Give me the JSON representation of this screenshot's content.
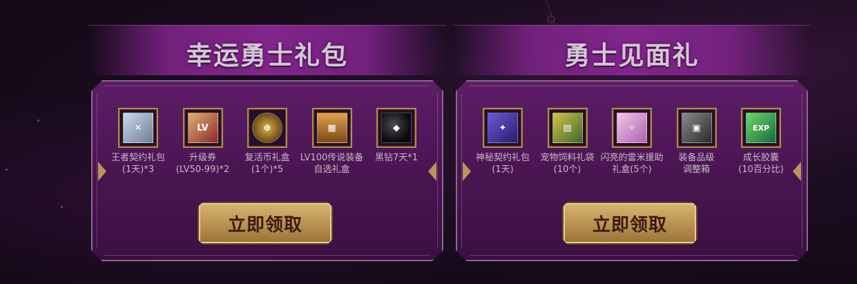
{
  "colors": {
    "panel_purple": "#5d1d66",
    "title_band": "#82268c",
    "gold_button": "#c9a461",
    "slot_border": "#b38a4e",
    "label_text": "#c9b8c8"
  },
  "panels": [
    {
      "title": "幸运勇士礼包",
      "items": [
        {
          "icon": "contract-scroll-icon",
          "label": "王者契约礼包\n(1天)*3"
        },
        {
          "icon": "level-up-ticket-icon",
          "label": "升级券\n(LV50-99)*2"
        },
        {
          "icon": "coin-box-icon",
          "label": "复活币礼盒\n(1个)*5"
        },
        {
          "icon": "legendary-chest-icon",
          "label": "LV100传说装备\n自选礼盒"
        },
        {
          "icon": "black-diamond-icon",
          "label": "黑钻7天*1"
        }
      ],
      "claim_label": "立即领取"
    },
    {
      "title": "勇士见面礼",
      "items": [
        {
          "icon": "mystic-contract-icon",
          "label": "神秘契约礼包\n(1天)"
        },
        {
          "icon": "pet-food-bag-icon",
          "label": "宠物饲料礼袋\n(10个)"
        },
        {
          "icon": "shining-raymi-box-icon",
          "label": "闪亮的雷米援助\n礼盒(5个)"
        },
        {
          "icon": "grade-adjust-box-icon",
          "label": "装备品级\n调整箱"
        },
        {
          "icon": "exp-capsule-icon",
          "label": "成长胶囊\n(10百分比)"
        }
      ],
      "claim_label": "立即领取"
    }
  ]
}
